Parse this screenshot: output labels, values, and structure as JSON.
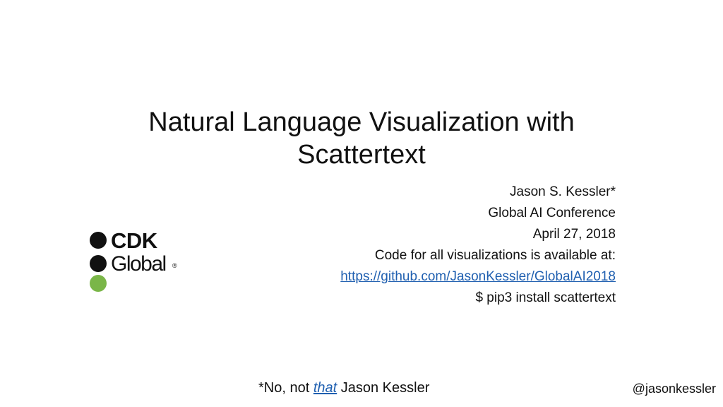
{
  "slide": {
    "title_line1": "Natural Language Visualization with",
    "title_line2": "Scattertext",
    "author": "Jason S. Kessler*",
    "conference": "Global AI Conference",
    "date": "April 27, 2018",
    "code_note": "Code for all visualizations is available at:",
    "repo_url": "https://github.com/JasonKessler/GlobalAI2018",
    "install_cmd": "$ pip3 install scattertext",
    "footnote_prefix": "*No, not ",
    "footnote_emphasis": "that",
    "footnote_suffix": " Jason Kessler",
    "handle": "@jasonkessler"
  },
  "logo": {
    "line1": "CDK",
    "line2": "Global",
    "reg_mark": "®",
    "dot_colors": [
      "#111111",
      "#111111",
      "#7ab648"
    ],
    "text_color": "#111111"
  },
  "colors": {
    "link": "#1f5fb0",
    "text": "#111111",
    "background": "#ffffff"
  }
}
